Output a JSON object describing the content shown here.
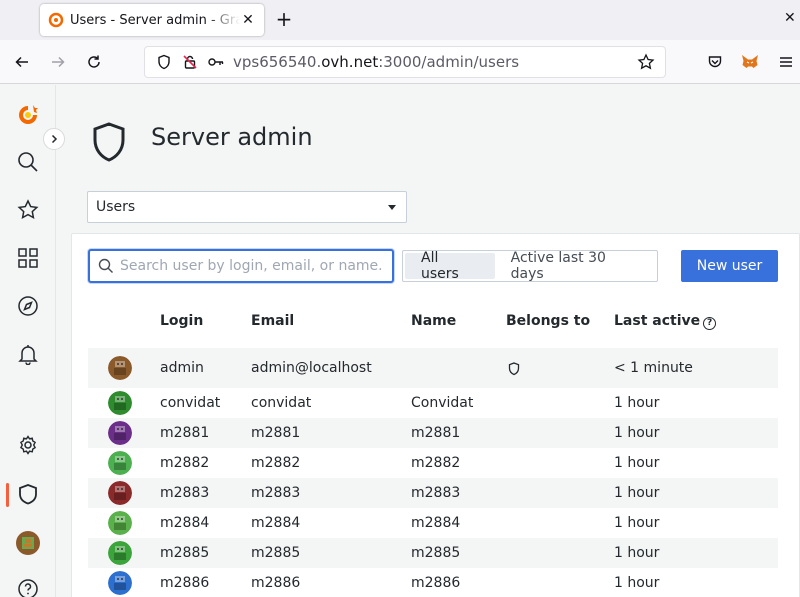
{
  "browser": {
    "tab_title": "Users - Server admin - Grafana",
    "url_prefix": "vps656540.",
    "url_host": "ovh.net",
    "url_path": ":3000/admin/users"
  },
  "page": {
    "title": "Server admin",
    "section_select": "Users"
  },
  "toolbar": {
    "search_placeholder": "Search user by login, email, or name.",
    "filter_all": "All users",
    "filter_active": "Active last 30 days",
    "new_user_label": "New user"
  },
  "table": {
    "columns": [
      "Login",
      "Email",
      "Name",
      "Belongs to",
      "Last active"
    ],
    "rows": [
      {
        "login": "admin",
        "email": "admin@localhost",
        "name": "",
        "belongs": "shield",
        "last_active": "< 1 minute",
        "avatar_color": "#8a5a2b"
      },
      {
        "login": "convidat",
        "email": "convidat",
        "name": "Convidat",
        "belongs": "",
        "last_active": "1 hour",
        "avatar_color": "#2e8b2e"
      },
      {
        "login": "m2881",
        "email": "m2881",
        "name": "m2881",
        "belongs": "",
        "last_active": "1 hour",
        "avatar_color": "#6b2f8a"
      },
      {
        "login": "m2882",
        "email": "m2882",
        "name": "m2882",
        "belongs": "",
        "last_active": "1 hour",
        "avatar_color": "#4caf50"
      },
      {
        "login": "m2883",
        "email": "m2883",
        "name": "m2883",
        "belongs": "",
        "last_active": "1 hour",
        "avatar_color": "#8b2a2a"
      },
      {
        "login": "m2884",
        "email": "m2884",
        "name": "m2884",
        "belongs": "",
        "last_active": "1 hour",
        "avatar_color": "#5ab04a"
      },
      {
        "login": "m2885",
        "email": "m2885",
        "name": "m2885",
        "belongs": "",
        "last_active": "1 hour",
        "avatar_color": "#3ba43b"
      },
      {
        "login": "m2886",
        "email": "m2886",
        "name": "m2886",
        "belongs": "",
        "last_active": "1 hour",
        "avatar_color": "#2d6fcf"
      }
    ]
  },
  "colors": {
    "primary": "#3871dc",
    "brand": "#f55f3e"
  }
}
